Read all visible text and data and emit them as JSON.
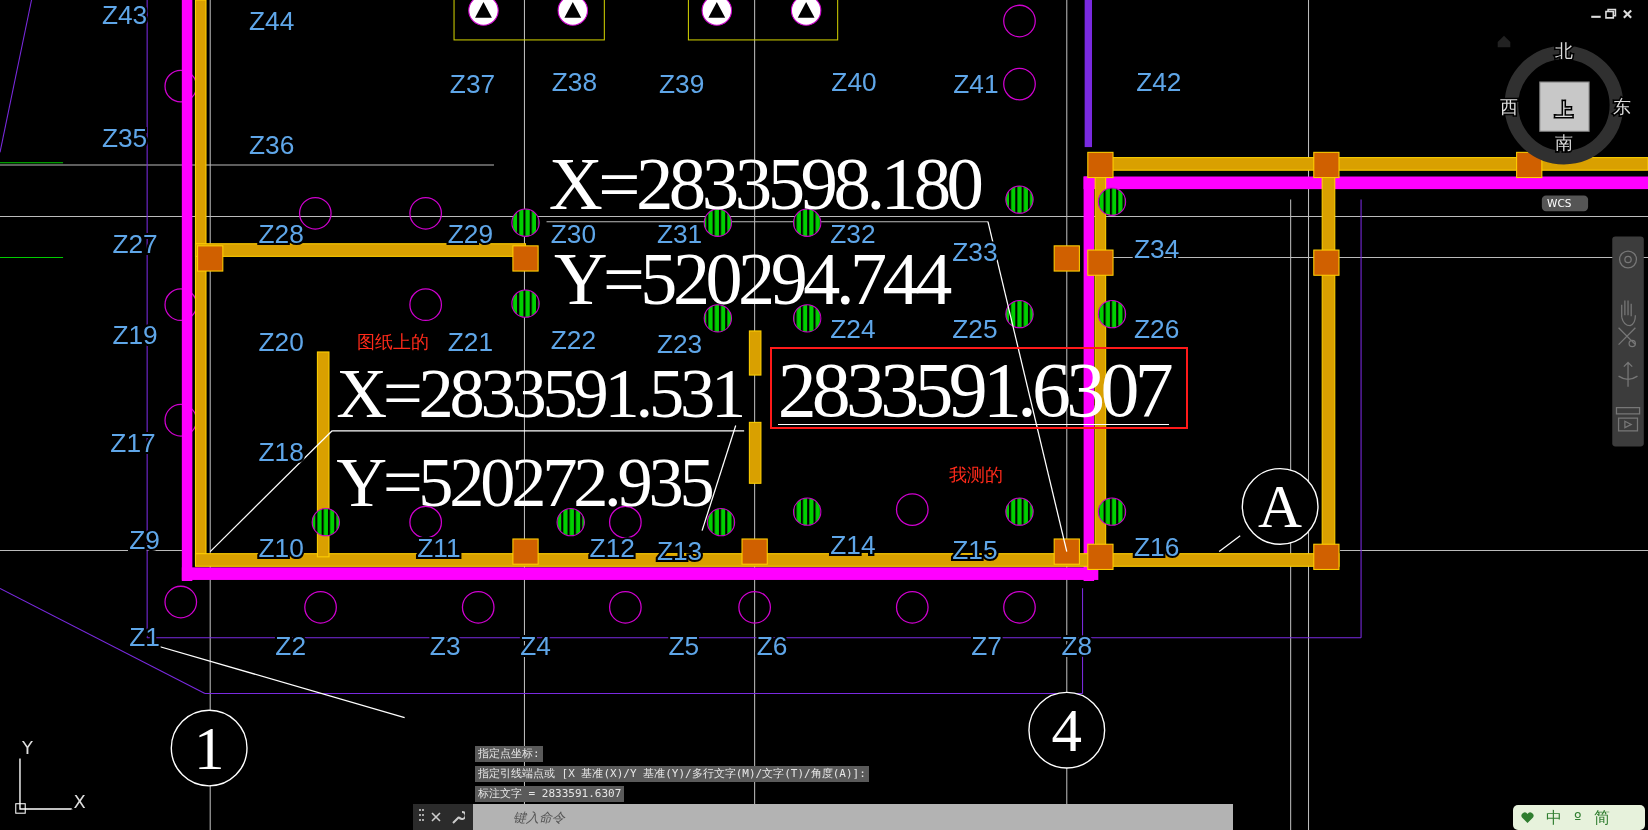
{
  "viewcube": {
    "north": "北",
    "south": "南",
    "west": "西",
    "east": "东",
    "face": "上",
    "ucs": "WCS"
  },
  "column_labels": [
    "Z43",
    "Z44",
    "Z37",
    "Z38",
    "Z39",
    "Z40",
    "Z41",
    "Z42",
    "Z35",
    "Z36",
    "Z27",
    "Z28",
    "Z29",
    "Z30",
    "Z31",
    "Z32",
    "Z33",
    "Z34",
    "Z19",
    "Z20",
    "Z21",
    "Z22",
    "Z23",
    "Z24",
    "Z25",
    "Z26",
    "Z17",
    "Z18",
    "Z9",
    "Z10",
    "Z11",
    "Z12",
    "Z13",
    "Z14",
    "Z15",
    "Z16",
    "Z1",
    "Z2",
    "Z3",
    "Z4",
    "Z5",
    "Z6",
    "Z7",
    "Z8"
  ],
  "coordinate_annotations": [
    {
      "x_text": "X=2833598.180",
      "y_text": "Y=520294.744"
    },
    {
      "x_text": "X=2833591.531",
      "y_text": "Y=520272.935"
    }
  ],
  "measured_value": "2833591.6307",
  "notes": [
    "图纸上的",
    "我测的"
  ],
  "axis_bubbles": [
    "1",
    "4",
    "A"
  ],
  "ucs_icon": {
    "x": "X",
    "y": "Y"
  },
  "command_history": [
    "指定点坐标:",
    "指定引线端点或 [X 基准(X)/Y 基准(Y)/多行文字(M)/文字(T)/角度(A)]:",
    "标注文字 = 2833591.6307"
  ],
  "command_line": {
    "placeholder": "键入命令"
  },
  "ime_bar": [
    "中",
    "º",
    "简"
  ]
}
